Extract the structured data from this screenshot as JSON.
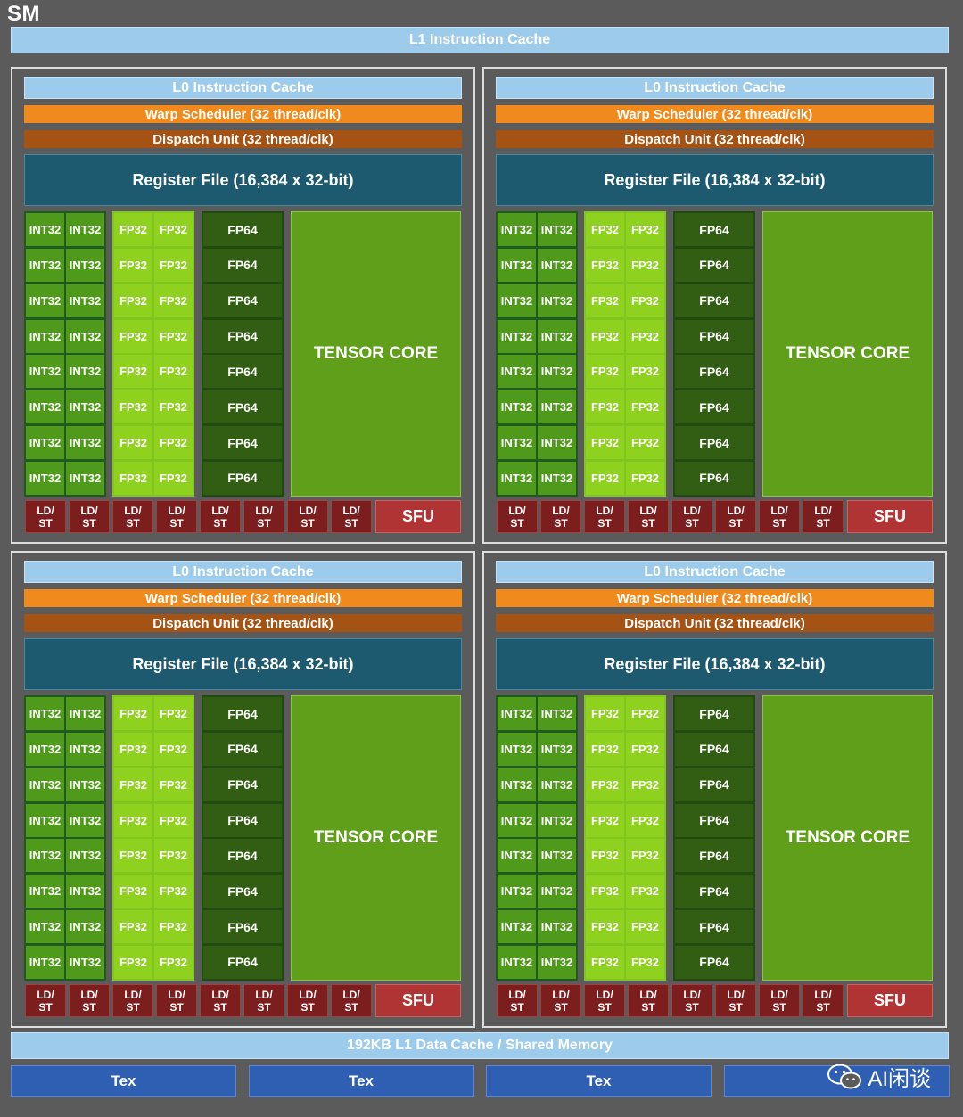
{
  "sm_label": "SM",
  "l1_instruction_cache": "L1 Instruction Cache",
  "partitions": [
    {
      "l0_cache": "L0 Instruction Cache",
      "warp_scheduler": "Warp Scheduler (32 thread/clk)",
      "dispatch_unit": "Dispatch Unit (32 thread/clk)",
      "register_file": "Register File (16,384 x 32-bit)",
      "int_label": "INT32",
      "fp32_label": "FP32",
      "fp64_label": "FP64",
      "tensor_core": "TENSOR CORE",
      "ldst_top": "LD/",
      "ldst_bottom": "ST",
      "sfu": "SFU"
    },
    {
      "l0_cache": "L0 Instruction Cache",
      "warp_scheduler": "Warp Scheduler (32 thread/clk)",
      "dispatch_unit": "Dispatch Unit (32 thread/clk)",
      "register_file": "Register File (16,384 x 32-bit)",
      "int_label": "INT32",
      "fp32_label": "FP32",
      "fp64_label": "FP64",
      "tensor_core": "TENSOR CORE",
      "ldst_top": "LD/",
      "ldst_bottom": "ST",
      "sfu": "SFU"
    },
    {
      "l0_cache": "L0 Instruction Cache",
      "warp_scheduler": "Warp Scheduler (32 thread/clk)",
      "dispatch_unit": "Dispatch Unit (32 thread/clk)",
      "register_file": "Register File (16,384 x 32-bit)",
      "int_label": "INT32",
      "fp32_label": "FP32",
      "fp64_label": "FP64",
      "tensor_core": "TENSOR CORE",
      "ldst_top": "LD/",
      "ldst_bottom": "ST",
      "sfu": "SFU"
    },
    {
      "l0_cache": "L0 Instruction Cache",
      "warp_scheduler": "Warp Scheduler (32 thread/clk)",
      "dispatch_unit": "Dispatch Unit (32 thread/clk)",
      "register_file": "Register File (16,384 x 32-bit)",
      "int_label": "INT32",
      "fp32_label": "FP32",
      "fp64_label": "FP64",
      "tensor_core": "TENSOR CORE",
      "ldst_top": "LD/",
      "ldst_bottom": "ST",
      "sfu": "SFU"
    }
  ],
  "l1_data_cache": "192KB L1 Data Cache / Shared Memory",
  "tex_units": [
    "Tex",
    "Tex",
    "Tex",
    ""
  ],
  "watermark": {
    "text": "AI闲谈",
    "icon": "wechat-icon"
  },
  "colors": {
    "background": "#5b5b5b",
    "cache_blue": "#9dcbec",
    "warp_orange": "#f08a1d",
    "dispatch_brown": "#a55314",
    "register_teal": "#1d5a70",
    "int32_green": "#4f9a1a",
    "fp32_green": "#8ed11f",
    "fp64_green": "#315e12",
    "tensor_green": "#5f9f1a",
    "ldst_red": "#7d1e1e",
    "sfu_red": "#b03434",
    "tex_blue": "#2f5fb3"
  }
}
